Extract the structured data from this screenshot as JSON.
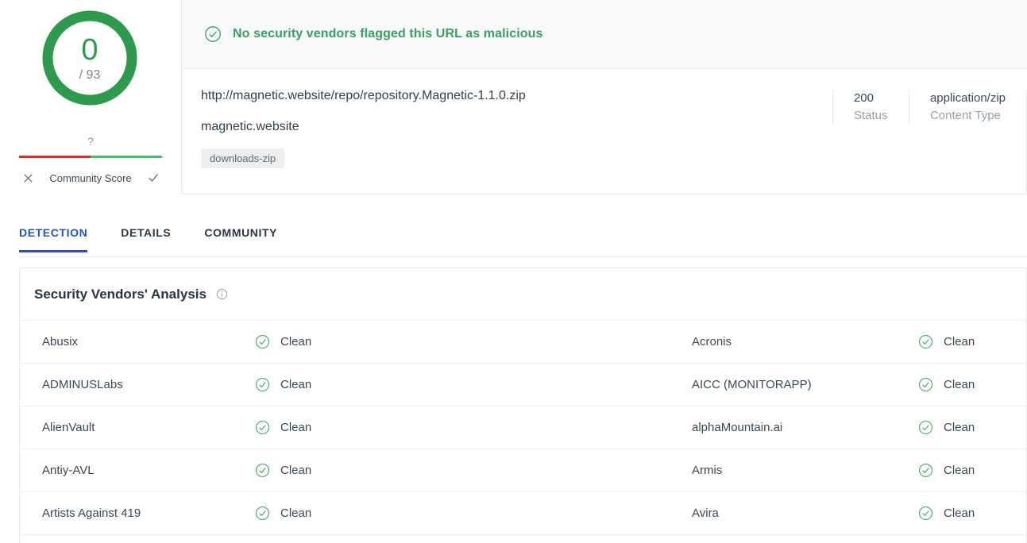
{
  "score": {
    "detections": "0",
    "total": "/ 93",
    "ring_color": "#2e9a4e"
  },
  "community_score": {
    "question_mark": "?",
    "label": "Community Score",
    "negative_icon": "x-icon",
    "positive_icon": "check-icon",
    "bar_negative_color": "#c0392b",
    "bar_positive_color": "#5cb377"
  },
  "banner": {
    "icon": "check-circle-icon",
    "message": "No security vendors flagged this URL as malicious",
    "color": "#3a9e5f"
  },
  "target": {
    "url": "http://magnetic.website/repo/repository.Magnetic-1.1.0.zip",
    "domain": "magnetic.website",
    "tag": "downloads-zip"
  },
  "meta": [
    {
      "value": "200",
      "key": "Status"
    },
    {
      "value": "application/zip",
      "key": "Content Type"
    }
  ],
  "tabs": [
    {
      "label": "DETECTION",
      "active": true
    },
    {
      "label": "DETAILS",
      "active": false
    },
    {
      "label": "COMMUNITY",
      "active": false
    }
  ],
  "analysis": {
    "title": "Security Vendors' Analysis",
    "info_icon": "info-icon",
    "rows": [
      {
        "left_vendor": "Abusix",
        "left_result": "Clean",
        "right_vendor": "Acronis",
        "right_result": "Clean"
      },
      {
        "left_vendor": "ADMINUSLabs",
        "left_result": "Clean",
        "right_vendor": "AICC (MONITORAPP)",
        "right_result": "Clean"
      },
      {
        "left_vendor": "AlienVault",
        "left_result": "Clean",
        "right_vendor": "alphaMountain.ai",
        "right_result": "Clean"
      },
      {
        "left_vendor": "Antiy-AVL",
        "left_result": "Clean",
        "right_vendor": "Armis",
        "right_result": "Clean"
      },
      {
        "left_vendor": "Artists Against 419",
        "left_result": "Clean",
        "right_vendor": "Avira",
        "right_result": "Clean"
      }
    ]
  }
}
